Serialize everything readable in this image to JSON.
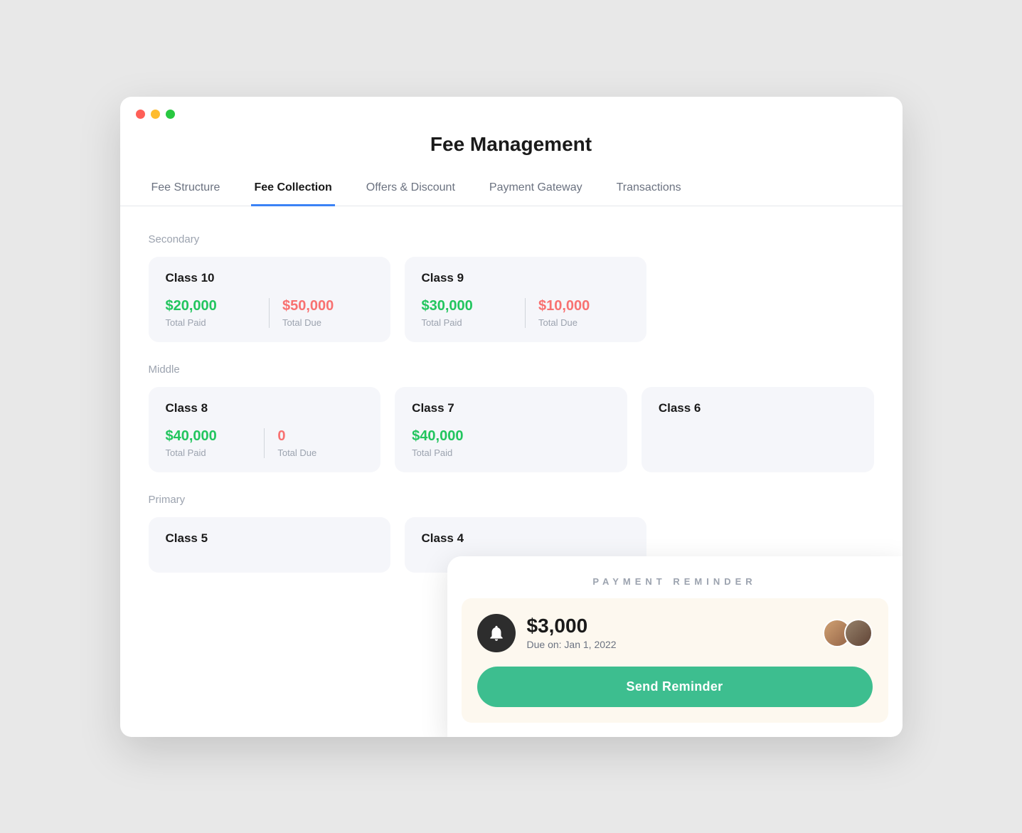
{
  "window": {
    "title": "Fee Management"
  },
  "tabs": [
    {
      "id": "fee-structure",
      "label": "Fee Structure",
      "active": false
    },
    {
      "id": "fee-collection",
      "label": "Fee Collection",
      "active": true
    },
    {
      "id": "offers-discount",
      "label": "Offers & Discount",
      "active": false
    },
    {
      "id": "payment-gateway",
      "label": "Payment Gateway",
      "active": false
    },
    {
      "id": "transactions",
      "label": "Transactions",
      "active": false
    }
  ],
  "sections": [
    {
      "id": "secondary",
      "label": "Secondary",
      "cards": [
        {
          "id": "class-10",
          "title": "Class 10",
          "paid_amount": "$20,000",
          "paid_label": "Total Paid",
          "due_amount": "$50,000",
          "due_label": "Total Due"
        },
        {
          "id": "class-9",
          "title": "Class 9",
          "paid_amount": "$30,000",
          "paid_label": "Total Paid",
          "due_amount": "$10,000",
          "due_label": "Total Due"
        }
      ]
    },
    {
      "id": "middle",
      "label": "Middle",
      "cards": [
        {
          "id": "class-8",
          "title": "Class 8",
          "paid_amount": "$40,000",
          "paid_label": "Total Paid",
          "due_amount": "0",
          "due_label": "Total Due",
          "due_zero": true
        },
        {
          "id": "class-7",
          "title": "Class 7",
          "paid_amount": "$40,000",
          "paid_label": "Total Paid",
          "due_amount": "",
          "due_label": ""
        },
        {
          "id": "class-6",
          "title": "Class 6",
          "paid_amount": "",
          "paid_label": "",
          "due_amount": "",
          "due_label": ""
        }
      ]
    },
    {
      "id": "primary",
      "label": "Primary",
      "cards": [
        {
          "id": "class-5",
          "title": "Class 5",
          "paid_amount": "",
          "paid_label": "",
          "due_amount": "",
          "due_label": ""
        },
        {
          "id": "class-4",
          "title": "Class 4",
          "paid_amount": "",
          "paid_label": "",
          "due_amount": "",
          "due_label": ""
        }
      ]
    }
  ],
  "reminder": {
    "header": "PAYMENT REMINDER",
    "amount": "$3,000",
    "due_date": "Due on: Jan 1, 2022",
    "button_label": "Send Reminder"
  }
}
